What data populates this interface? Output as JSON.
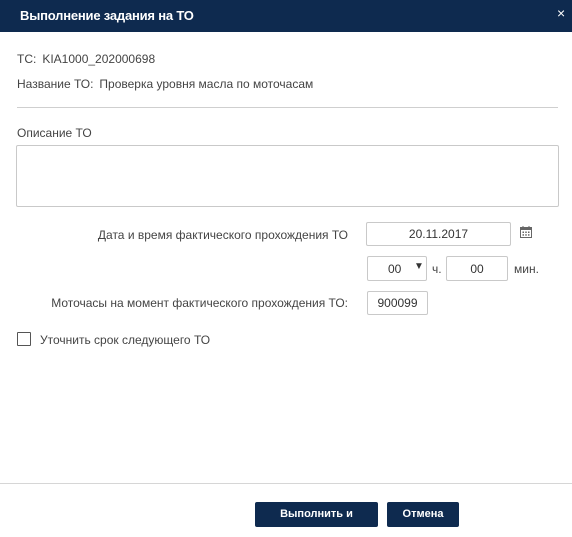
{
  "dialog": {
    "title": "Выполнение задания на ТО",
    "close_glyph": "×"
  },
  "info": {
    "ts_label": "ТС:",
    "ts_value": "KIA1000_202000698",
    "to_name_label": "Название ТО:",
    "to_name_value": "Проверка уровня масла по моточасам"
  },
  "description": {
    "label": "Описание ТО",
    "value": ""
  },
  "datetime": {
    "label": "Дата и время фактического прохождения ТО",
    "date_value": "20.11.2017",
    "hours_value": "00",
    "hours_unit": "ч.",
    "minutes_value": "00",
    "minutes_unit": "мин."
  },
  "motohours": {
    "label": "Моточасы на момент фактического прохождения ТО:",
    "value": "900099"
  },
  "next_term": {
    "label": "Уточнить срок следующего ТО",
    "checked": false
  },
  "footer": {
    "execute_label": "Выполнить и продлить",
    "cancel_label": "Отмена"
  },
  "icons": {
    "close": "close-icon",
    "calendar": "calendar-icon",
    "dropdown": "chevron-down-icon"
  },
  "colors": {
    "header_bg": "#0e2a4f",
    "button_bg": "#0e2a4f",
    "border": "#c9c9c9"
  }
}
